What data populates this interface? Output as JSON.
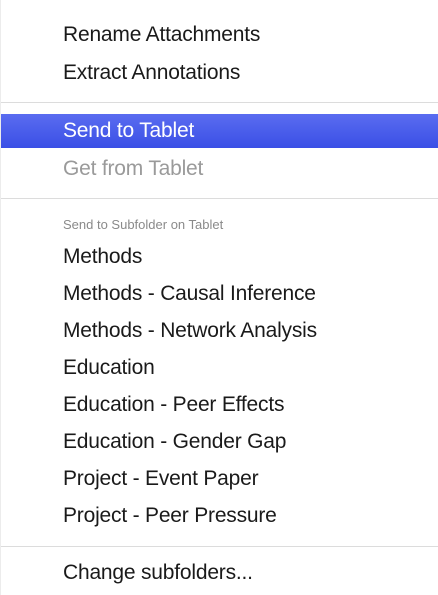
{
  "menu": {
    "top_items": [
      {
        "label": "Rename Attachments"
      },
      {
        "label": "Extract Annotations"
      }
    ],
    "tablet_items": [
      {
        "label": "Send to Tablet",
        "state": "highlighted"
      },
      {
        "label": "Get from Tablet",
        "state": "disabled"
      }
    ],
    "subfolder_header": "Send to Subfolder on Tablet",
    "subfolders": [
      {
        "label": "Methods"
      },
      {
        "label": "Methods - Causal Inference"
      },
      {
        "label": "Methods - Network Analysis"
      },
      {
        "label": "Education"
      },
      {
        "label": "Education - Peer Effects"
      },
      {
        "label": "Education - Gender Gap"
      },
      {
        "label": "Project - Event Paper"
      },
      {
        "label": "Project - Peer Pressure"
      }
    ],
    "change_subfolders": "Change subfolders..."
  },
  "colors": {
    "highlight": "#4a5ef0",
    "disabled_text": "#9a9a9a",
    "section_header_text": "#8a8a8a"
  }
}
